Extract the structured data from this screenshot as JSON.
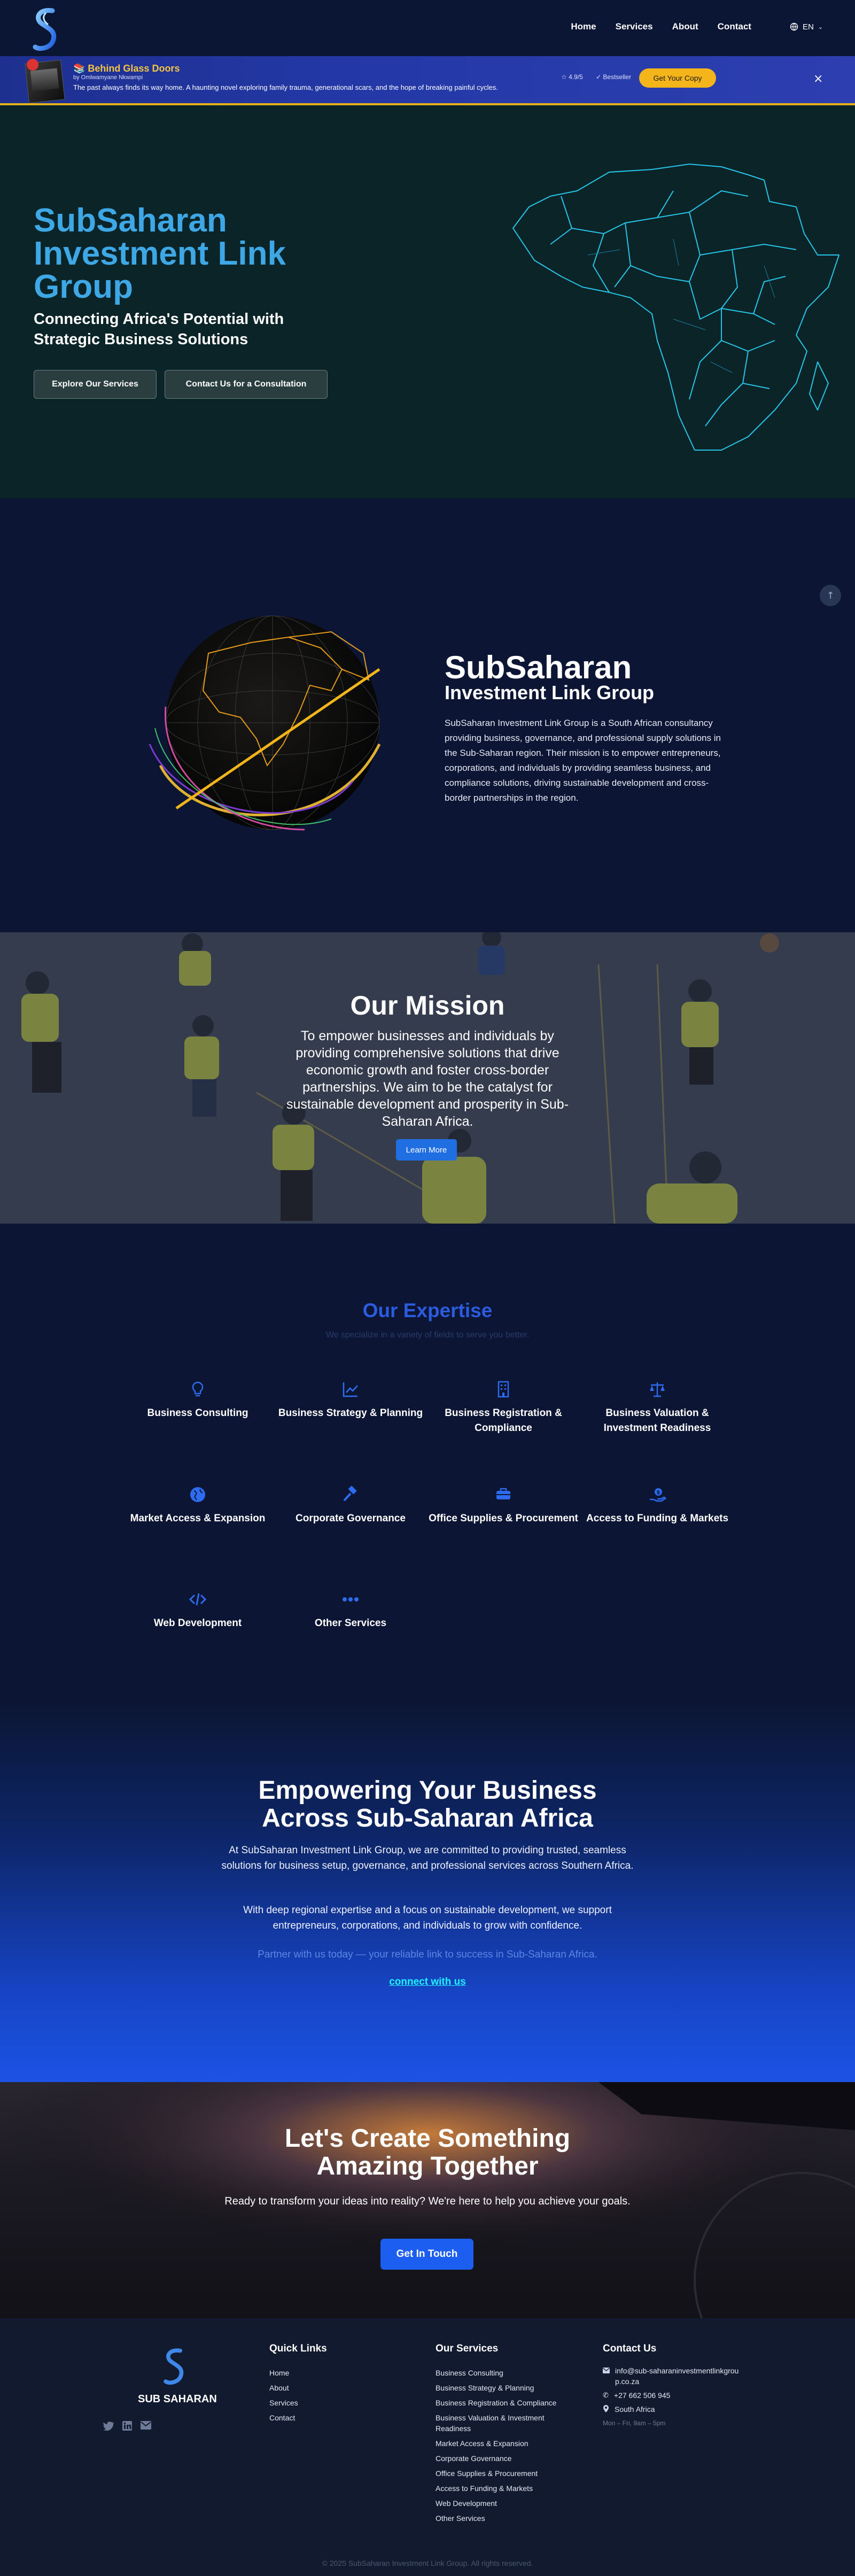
{
  "nav": {
    "links": [
      "Home",
      "Services",
      "About",
      "Contact"
    ],
    "language": "EN"
  },
  "banner": {
    "title": "📚 Behind Glass Doors",
    "author": "by Omlwamyane Nkwampi",
    "description": "The past always finds its way home. A haunting novel exploring family trauma, generational scars, and the hope of breaking painful cycles.",
    "rating": "☆ 4.9/5",
    "bestseller": "✓ Bestseller",
    "button": "Get Your Copy",
    "close": "×"
  },
  "hero": {
    "title": "SubSaharan Investment Link Group",
    "subtitle": "Connecting Africa's Potential with Strategic Business Solutions",
    "btn_services": "Explore Our Services",
    "btn_consult": "Contact Us for a Consultation"
  },
  "about": {
    "title": "SubSaharan",
    "subtitle": "Investment Link Group",
    "body": "SubSaharan Investment Link Group is a South African consultancy providing business, governance, and professional supply solutions in the Sub-Saharan region. Their mission is to empower entrepreneurs, corporations, and individuals by providing seamless business, and compliance solutions, driving sustainable development and cross-border partnerships in the region."
  },
  "mission": {
    "title": "Our Mission",
    "body": "To empower businesses and individuals by providing comprehensive solutions that drive economic growth and foster cross-border partnerships. We aim to be the catalyst for sustainable development and prosperity in Sub-Saharan Africa.",
    "button": "Learn More"
  },
  "expertise": {
    "title": "Our Expertise",
    "subtitle": "We specialize in a variety of fields to serve you better.",
    "items": [
      {
        "label": "Business Consulting",
        "icon": "lightbulb-icon"
      },
      {
        "label": "Business Strategy & Planning",
        "icon": "chart-line-icon"
      },
      {
        "label": "Business Registration & Compliance",
        "icon": "building-icon"
      },
      {
        "label": "Business Valuation & Investment Readiness",
        "icon": "scale-icon"
      },
      {
        "label": "Market Access & Expansion",
        "icon": "globe-icon"
      },
      {
        "label": "Corporate Governance",
        "icon": "gavel-icon"
      },
      {
        "label": "Office Supplies & Procurement",
        "icon": "briefcase-icon"
      },
      {
        "label": "Access to Funding & Markets",
        "icon": "hand-holding-dollar-icon"
      },
      {
        "label": "Web Development",
        "icon": "code-icon"
      },
      {
        "label": "Other Services",
        "icon": "ellipsis-icon"
      }
    ]
  },
  "empower": {
    "title": "Empowering Your Business Across Sub-Saharan Africa",
    "p1": "At SubSaharan Investment Link Group, we are committed to providing trusted, seamless solutions for business setup, governance, and professional services across Southern Africa.",
    "p2": "With deep regional expertise and a focus on sustainable development, we support entrepreneurs, corporations, and individuals to grow with confidence.",
    "p3": "Partner with us today — your reliable link to success in Sub-Saharan Africa.",
    "link": "connect with us"
  },
  "cta": {
    "title": "Let's Create Something Amazing Together",
    "body": "Ready to transform your ideas into reality? We're here to help you achieve your goals.",
    "button": "Get In Touch"
  },
  "footer": {
    "brand": "SUB SAHARAN",
    "quick_links_title": "Quick Links",
    "quick_links": [
      "Home",
      "About",
      "Services",
      "Contact"
    ],
    "services_title": "Our Services",
    "services": [
      "Business Consulting",
      "Business Strategy & Planning",
      "Business Registration & Compliance",
      "Business Valuation & Investment Readiness",
      "Market Access & Expansion",
      "Corporate Governance",
      "Office Supplies & Procurement",
      "Access to Funding & Markets",
      "Web Development",
      "Other Services"
    ],
    "contact_title": "Contact Us",
    "email": "info@sub-saharaninvestmentlinkgroup.co.za",
    "phone": "+27 662 506 945",
    "location": "South Africa",
    "hours": "Mon – Fri, 9am – 5pm",
    "copyright": "© 2025 SubSaharan Investment Link Group. All rights reserved."
  },
  "colors": {
    "accent": "#1f6fe3",
    "hero_title": "#3ea8e6",
    "banner_button": "#f4b51b",
    "link": "#1ff3ff"
  }
}
